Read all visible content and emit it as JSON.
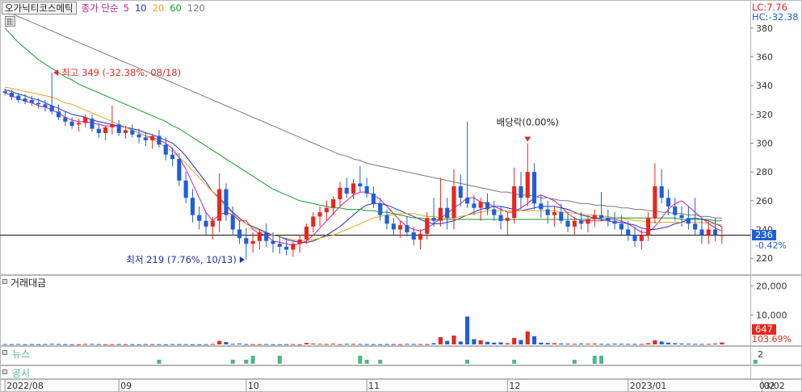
{
  "header": {
    "stock_name": "오가닉티코스메틱",
    "indicator": "종가 단순",
    "ma_periods": [
      {
        "label": "5",
        "color": "#e0188a"
      },
      {
        "label": "10",
        "color": "#1f2fd0"
      },
      {
        "label": "20",
        "color": "#f0a020"
      },
      {
        "label": "60",
        "color": "#1a9a2a"
      },
      {
        "label": "120",
        "color": "#7a7a7a"
      }
    ]
  },
  "price_axis": {
    "ticks": [
      "380",
      "360",
      "340",
      "320",
      "300",
      "280",
      "260",
      "240",
      "220"
    ],
    "lc_label": "LC:7.76",
    "hc_label": "HC:-32.38",
    "current_price": "236",
    "current_change": "-0.42%"
  },
  "annotations": {
    "high": "최고 349 (-32.38%, 08/18)",
    "low": "최저 219 (7.76%, 10/13)",
    "dividend": "배당락(0.00%)"
  },
  "volume_panel": {
    "title": "거래대금",
    "ticks": [
      "20,000",
      "10,000"
    ],
    "current_value": "647",
    "current_change": "103.69%"
  },
  "news_panel": {
    "title": "뉴스",
    "tick": "2"
  },
  "disclosure_panel": {
    "title": "공시"
  },
  "x_axis": {
    "labels": [
      "2022/08",
      "09",
      "10",
      "11",
      "12",
      "2023/01",
      "02",
      "03",
      "03/02"
    ]
  },
  "colors": {
    "up": "#e8261e",
    "down": "#1f5fd8",
    "ref_line": "#000000",
    "price_box": "#1f5fd8",
    "volume_box": "#e8261e",
    "news_bar": "#4cb88a"
  },
  "chart_data": {
    "type": "candlestick",
    "ylim": [
      210,
      395
    ],
    "ref_line": 236,
    "candles": [
      [
        336,
        338,
        333,
        335
      ],
      [
        335,
        337,
        330,
        332
      ],
      [
        333,
        335,
        328,
        330
      ],
      [
        331,
        334,
        327,
        329
      ],
      [
        330,
        333,
        326,
        328
      ],
      [
        328,
        331,
        324,
        327
      ],
      [
        327,
        330,
        322,
        325
      ],
      [
        326,
        349,
        320,
        322
      ],
      [
        322,
        327,
        316,
        318
      ],
      [
        318,
        322,
        312,
        315
      ],
      [
        315,
        318,
        310,
        312
      ],
      [
        313,
        317,
        308,
        314
      ],
      [
        314,
        320,
        311,
        318
      ],
      [
        317,
        320,
        308,
        310
      ],
      [
        310,
        314,
        304,
        307
      ],
      [
        307,
        312,
        302,
        311
      ],
      [
        311,
        326,
        306,
        313
      ],
      [
        313,
        316,
        305,
        307
      ],
      [
        307,
        312,
        303,
        309
      ],
      [
        309,
        313,
        304,
        306
      ],
      [
        306,
        310,
        300,
        304
      ],
      [
        304,
        308,
        298,
        302
      ],
      [
        302,
        306,
        296,
        305
      ],
      [
        305,
        309,
        297,
        299
      ],
      [
        299,
        304,
        288,
        292
      ],
      [
        292,
        297,
        284,
        289
      ],
      [
        289,
        293,
        270,
        274
      ],
      [
        274,
        280,
        258,
        262
      ],
      [
        262,
        268,
        245,
        250
      ],
      [
        250,
        256,
        240,
        246
      ],
      [
        246,
        252,
        236,
        242
      ],
      [
        242,
        249,
        233,
        246
      ],
      [
        246,
        279,
        238,
        268
      ],
      [
        268,
        272,
        246,
        250
      ],
      [
        250,
        256,
        236,
        240
      ],
      [
        240,
        246,
        230,
        234
      ],
      [
        234,
        241,
        219,
        230
      ],
      [
        230,
        238,
        224,
        232
      ],
      [
        232,
        240,
        226,
        238
      ],
      [
        238,
        244,
        228,
        232
      ],
      [
        232,
        238,
        224,
        230
      ],
      [
        230,
        236,
        223,
        228
      ],
      [
        228,
        234,
        222,
        226
      ],
      [
        226,
        232,
        221,
        230
      ],
      [
        230,
        236,
        224,
        233
      ],
      [
        233,
        244,
        230,
        242
      ],
      [
        242,
        252,
        238,
        249
      ],
      [
        249,
        256,
        242,
        252
      ],
      [
        252,
        260,
        246,
        255
      ],
      [
        255,
        263,
        250,
        261
      ],
      [
        261,
        273,
        256,
        269
      ],
      [
        269,
        276,
        262,
        265
      ],
      [
        265,
        275,
        261,
        272
      ],
      [
        272,
        284,
        266,
        270
      ],
      [
        270,
        276,
        262,
        265
      ],
      [
        265,
        270,
        255,
        258
      ],
      [
        258,
        262,
        246,
        250
      ],
      [
        250,
        254,
        240,
        244
      ],
      [
        244,
        248,
        236,
        240
      ],
      [
        240,
        246,
        234,
        243
      ],
      [
        243,
        249,
        235,
        238
      ],
      [
        238,
        242,
        229,
        233
      ],
      [
        233,
        240,
        226,
        237
      ],
      [
        237,
        252,
        233,
        248
      ],
      [
        248,
        262,
        242,
        246
      ],
      [
        246,
        276,
        242,
        255
      ],
      [
        255,
        262,
        240,
        248
      ],
      [
        248,
        282,
        240,
        270
      ],
      [
        270,
        278,
        256,
        262
      ],
      [
        262,
        315,
        255,
        258
      ],
      [
        258,
        264,
        250,
        255
      ],
      [
        255,
        262,
        246,
        259
      ],
      [
        259,
        265,
        250,
        254
      ],
      [
        254,
        260,
        246,
        250
      ],
      [
        250,
        256,
        240,
        246
      ],
      [
        246,
        252,
        236,
        248
      ],
      [
        248,
        283,
        244,
        270
      ],
      [
        270,
        280,
        254,
        262
      ],
      [
        262,
        300,
        256,
        280
      ],
      [
        280,
        286,
        254,
        258
      ],
      [
        258,
        264,
        248,
        254
      ],
      [
        254,
        260,
        244,
        250
      ],
      [
        250,
        256,
        242,
        252
      ],
      [
        252,
        258,
        244,
        246
      ],
      [
        246,
        252,
        238,
        242
      ],
      [
        242,
        248,
        236,
        246
      ],
      [
        246,
        252,
        240,
        244
      ],
      [
        244,
        250,
        238,
        247
      ],
      [
        247,
        254,
        242,
        250
      ],
      [
        250,
        266,
        246,
        248
      ],
      [
        248,
        254,
        242,
        246
      ],
      [
        246,
        252,
        240,
        244
      ],
      [
        244,
        250,
        236,
        240
      ],
      [
        240,
        246,
        232,
        236
      ],
      [
        236,
        242,
        228,
        232
      ],
      [
        232,
        240,
        226,
        236
      ],
      [
        236,
        252,
        232,
        248
      ],
      [
        248,
        286,
        244,
        270
      ],
      [
        270,
        282,
        258,
        262
      ],
      [
        262,
        268,
        250,
        256
      ],
      [
        256,
        262,
        246,
        250
      ],
      [
        250,
        256,
        242,
        248
      ],
      [
        248,
        256,
        240,
        244
      ],
      [
        244,
        262,
        236,
        240
      ],
      [
        240,
        248,
        230,
        236
      ],
      [
        236,
        246,
        230,
        240
      ],
      [
        240,
        248,
        232,
        236
      ],
      [
        236,
        242,
        230,
        236
      ]
    ],
    "ma": {
      "5": [
        335,
        333,
        331,
        329,
        328,
        326,
        325,
        323,
        321,
        318,
        316,
        315,
        315,
        314,
        313,
        312,
        312,
        312,
        311,
        309,
        307,
        305,
        304,
        302,
        300,
        296,
        290,
        282,
        272,
        262,
        252,
        246,
        250,
        252,
        250,
        246,
        246,
        240,
        237,
        236,
        232,
        231,
        230,
        229,
        230,
        232,
        236,
        241,
        246,
        251,
        256,
        260,
        264,
        266,
        266,
        264,
        261,
        256,
        251,
        246,
        242,
        240,
        239,
        241,
        244,
        248,
        251,
        255,
        258,
        262,
        262,
        259,
        258,
        256,
        254,
        252,
        252,
        255,
        258,
        262,
        264,
        262,
        260,
        256,
        251,
        248,
        246,
        246,
        246,
        246,
        247,
        247,
        246,
        244,
        241,
        238,
        238,
        242,
        248,
        254,
        258,
        260,
        256,
        252,
        248,
        244,
        241,
        239
      ],
      "10": [
        337,
        336,
        334,
        333,
        331,
        330,
        328,
        326,
        324,
        322,
        320,
        319,
        318,
        316,
        315,
        314,
        313,
        312,
        311,
        310,
        309,
        307,
        306,
        304,
        302,
        300,
        296,
        291,
        285,
        279,
        273,
        266,
        262,
        257,
        252,
        248,
        244,
        242,
        240,
        238,
        236,
        235,
        233,
        232,
        231,
        231,
        232,
        234,
        236,
        239,
        242,
        246,
        250,
        254,
        257,
        258,
        258,
        257,
        255,
        253,
        251,
        249,
        247,
        245,
        244,
        244,
        245,
        246,
        248,
        250,
        252,
        254,
        255,
        256,
        256,
        255,
        254,
        253,
        254,
        255,
        256,
        256,
        256,
        255,
        254,
        252,
        250,
        249,
        248,
        247,
        246,
        245,
        245,
        244,
        243,
        241,
        240,
        240,
        241,
        242,
        244,
        245,
        247,
        248,
        247,
        246,
        244,
        242
      ],
      "20": [
        339,
        338,
        337,
        336,
        335,
        334,
        333,
        332,
        330,
        328,
        327,
        325,
        323,
        321,
        319,
        317,
        315,
        313,
        311,
        309,
        307,
        305,
        303,
        300,
        297,
        294,
        290,
        286,
        281,
        276,
        271,
        266,
        261,
        256,
        251,
        247,
        244,
        241,
        239,
        237,
        236,
        235,
        234,
        233,
        232,
        232,
        233,
        234,
        235,
        236,
        238,
        240,
        242,
        244,
        246,
        248,
        249,
        250,
        250,
        251,
        251,
        251,
        250,
        249,
        249,
        248,
        248,
        248,
        249,
        250,
        251,
        252,
        253,
        253,
        253,
        253,
        253,
        253,
        253,
        253,
        253,
        253,
        253,
        252,
        252,
        251,
        251,
        250,
        250,
        249,
        249,
        248,
        248,
        247,
        246,
        246,
        245,
        245,
        245,
        245,
        245,
        245,
        245,
        245,
        245,
        244,
        244,
        243
      ],
      "60": [
        380,
        375,
        370,
        366,
        362,
        358,
        355,
        352,
        349,
        346,
        344,
        341,
        339,
        337,
        335,
        333,
        331,
        329,
        327,
        325,
        323,
        321,
        319,
        317,
        315,
        312,
        310,
        307,
        304,
        301,
        298,
        295,
        292,
        289,
        286,
        283,
        280,
        277,
        274,
        271,
        268,
        266,
        264,
        262,
        260,
        259,
        258,
        257,
        256,
        255,
        255,
        254,
        254,
        254,
        253,
        253,
        252,
        252,
        251,
        250,
        249,
        248,
        248,
        247,
        247,
        247,
        247,
        247,
        247,
        247,
        247,
        247,
        247,
        247,
        247,
        247,
        247,
        247,
        247,
        247,
        247,
        247,
        247,
        247,
        247,
        247,
        247,
        247,
        248,
        248,
        248,
        248,
        248,
        248,
        248,
        248,
        248,
        248,
        248,
        248,
        248,
        247,
        247,
        247,
        247,
        247,
        246,
        246
      ],
      "120": [
        392,
        390,
        388,
        386,
        384,
        382,
        380,
        378,
        376,
        374,
        372,
        370,
        368,
        366,
        364,
        362,
        360,
        358,
        356,
        354,
        352,
        350,
        348,
        346,
        344,
        342,
        340,
        338,
        336,
        334,
        332,
        330,
        328,
        326,
        324,
        322,
        320,
        318,
        316,
        314,
        312,
        310,
        308,
        306,
        304,
        302,
        300,
        298,
        296,
        294,
        292,
        291,
        289,
        288,
        286,
        285,
        284,
        283,
        282,
        281,
        280,
        279,
        278,
        277,
        276,
        275,
        274,
        273,
        272,
        271,
        270,
        269,
        268,
        267,
        266,
        266,
        265,
        264,
        264,
        263,
        262,
        262,
        261,
        260,
        260,
        259,
        258,
        258,
        257,
        257,
        256,
        256,
        255,
        255,
        254,
        254,
        253,
        253,
        252,
        252,
        251,
        251,
        250,
        250,
        249,
        249,
        248,
        248
      ]
    },
    "volume": [
      120,
      80,
      150,
      60,
      90,
      70,
      110,
      200,
      130,
      90,
      60,
      70,
      160,
      180,
      100,
      60,
      90,
      110,
      80,
      70,
      60,
      100,
      90,
      80,
      60,
      120,
      100,
      90,
      60,
      50,
      80,
      160,
      1200,
      800,
      200,
      300,
      120,
      90,
      80,
      100,
      70,
      60,
      80,
      90,
      60,
      500,
      300,
      200,
      150,
      250,
      100,
      200,
      180,
      150,
      120,
      100,
      80,
      120,
      100,
      90,
      200,
      150,
      120,
      100,
      400,
      2500,
      1200,
      3000,
      1000,
      9500,
      1800,
      1400,
      900,
      600,
      700,
      400,
      2200,
      1500,
      4400,
      2800,
      600,
      500,
      400,
      300,
      250,
      200,
      300,
      250,
      300,
      200,
      150,
      250,
      200,
      180,
      150,
      160,
      400,
      1400,
      1000,
      600,
      400,
      300,
      250,
      200,
      150,
      180,
      300,
      647
    ],
    "vol_ylim": [
      0,
      22000
    ],
    "news": [
      {
        "i": 23,
        "v": 1
      },
      {
        "i": 34,
        "v": 1
      },
      {
        "i": 36,
        "v": 1
      },
      {
        "i": 37,
        "v": 2
      },
      {
        "i": 41,
        "v": 2
      },
      {
        "i": 53,
        "v": 2
      },
      {
        "i": 54,
        "v": 1
      },
      {
        "i": 56,
        "v": 1
      },
      {
        "i": 69,
        "v": 1
      },
      {
        "i": 76,
        "v": 1
      },
      {
        "i": 85,
        "v": 1
      },
      {
        "i": 88,
        "v": 2
      },
      {
        "i": 89,
        "v": 2
      },
      {
        "i": 112,
        "v": 1
      }
    ],
    "x_ticks": [
      {
        "i": 0,
        "label": "2022/08"
      },
      {
        "i": 17,
        "label": "09"
      },
      {
        "i": 36,
        "label": "10"
      },
      {
        "i": 54,
        "label": "11"
      },
      {
        "i": 75,
        "label": "12"
      },
      {
        "i": 93,
        "label": "2023/01"
      },
      {
        "i": 113,
        "label": "02"
      },
      {
        "i": 132,
        "label": "03"
      }
    ]
  }
}
